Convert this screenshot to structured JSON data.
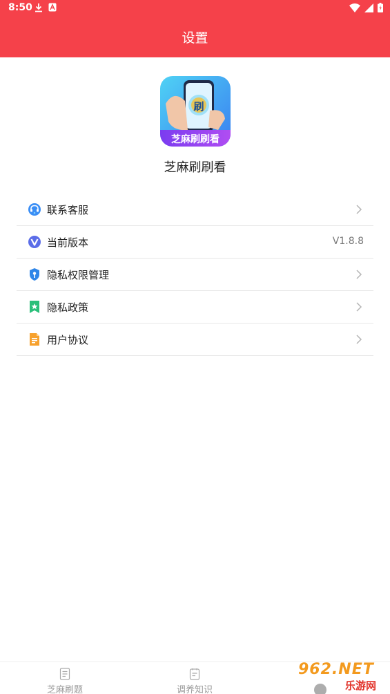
{
  "status_bar": {
    "time": "8:50"
  },
  "header": {
    "title": "设置"
  },
  "app": {
    "name": "芝麻刷刷看",
    "logo_badge": "芝麻刷刷看",
    "logo_glyph": "刷"
  },
  "menu": {
    "items": [
      {
        "label": "联系客服",
        "icon": "headset-icon",
        "value": ""
      },
      {
        "label": "当前版本",
        "icon": "version-v-icon",
        "value": "V1.8.8"
      },
      {
        "label": "隐私权限管理",
        "icon": "shield-key-icon",
        "value": ""
      },
      {
        "label": "隐私政策",
        "icon": "bookmark-star-icon",
        "value": ""
      },
      {
        "label": "用户协议",
        "icon": "document-icon",
        "value": ""
      }
    ]
  },
  "tabbar": {
    "tabs": [
      {
        "label": "芝麻刷题",
        "icon": "doc-list-icon"
      },
      {
        "label": "调养知识",
        "icon": "note-icon"
      }
    ]
  },
  "watermark": {
    "text_top": "962.NET",
    "text_bottom": "乐游网"
  },
  "colors": {
    "header_bg": "#f5414a",
    "divider": "#e6e6e6",
    "secondary_text": "#777777"
  }
}
